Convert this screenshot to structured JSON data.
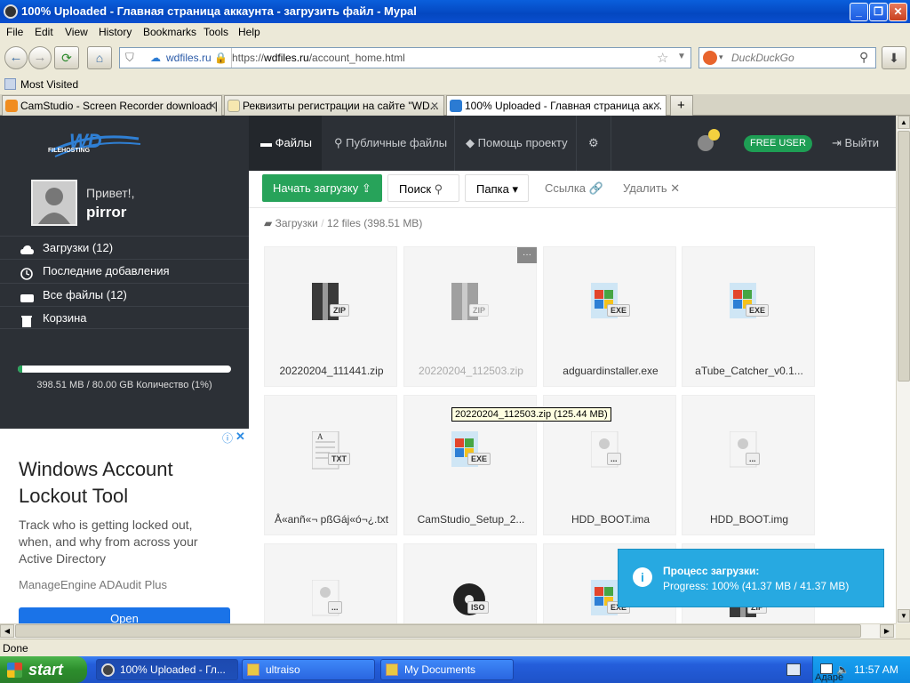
{
  "window": {
    "title": "100% Uploaded - Главная страница аккаунта - загрузить файл - Mypal"
  },
  "menu": [
    "File",
    "Edit",
    "View",
    "History",
    "Bookmarks",
    "Tools",
    "Help"
  ],
  "nav": {
    "site_label": "wdfiles.ru",
    "url_prefix": "https://",
    "url_host": "wdfiles.ru",
    "url_path": "/account_home.html",
    "search_placeholder": "DuckDuckGo"
  },
  "bookmarks": {
    "most_visited": "Most Visited"
  },
  "tabs": [
    {
      "label": "CamStudio - Screen Recorder download | ...",
      "close": "✕"
    },
    {
      "label": "Реквизиты регистрации на сайте \"WD...",
      "close": "✕"
    },
    {
      "label": "100% Uploaded - Главная страница ак...",
      "close": "✕"
    }
  ],
  "new_tab": "+",
  "site": {
    "logo_text": "WD",
    "logo_sub": "FILEHOSTING",
    "greeting": "Привет!,",
    "username": "pirror",
    "sidebar_items": [
      {
        "label": "Загрузки (12)"
      },
      {
        "label": "Последние добавления"
      },
      {
        "label": "Все файлы (12)"
      },
      {
        "label": "Корзина"
      }
    ],
    "storage_text": "398.51 MB / 80.00 GB Количество (1%)",
    "storage_fraction": 0.01,
    "topnav": {
      "files": "Файлы",
      "public_files": "Публичные файлы",
      "help": "Помощь проекту",
      "user_badge": "FREE USER",
      "logout": "Выйти"
    },
    "toolbar": {
      "upload": "Начать загрузку",
      "search": "Поиск",
      "folder": "Папка",
      "link": "Ссылка",
      "delete": "Удалить"
    },
    "breadcrumb": {
      "root": "Загрузки",
      "sep": "/",
      "count": "12 files",
      "size": "(398.51 MB)"
    },
    "files": [
      {
        "name": "20220204_111441.zip",
        "type": "ZIP"
      },
      {
        "name": "20220204_112503.zip",
        "type": "ZIP"
      },
      {
        "name": "adguardinstaller.exe",
        "type": "EXE"
      },
      {
        "name": "aTube_Catcher_v0.1...",
        "type": "EXE"
      },
      {
        "name": "Å«anñ«¬ pßGáj«ó¬¿.txt",
        "type": "TXT"
      },
      {
        "name": "CamStudio_Setup_2...",
        "type": "EXE"
      },
      {
        "name": "HDD_BOOT.ima",
        "type": "..."
      },
      {
        "name": "HDD_BOOT.img",
        "type": "..."
      },
      {
        "name": "",
        "type": "..."
      },
      {
        "name": "",
        "type": "ISO"
      },
      {
        "name": "",
        "type": "EXE"
      },
      {
        "name": "",
        "type": "ZIP"
      }
    ],
    "more_button": "···",
    "tooltip": "20220204_112503.zip (125.44 MB)",
    "notification": {
      "title": "Процесс загрузки:",
      "text": "Progress: 100% (41.37 MB / 41.37 MB)"
    }
  },
  "ad": {
    "title": "Windows Account Lockout Tool",
    "body": "Track who is getting locked out, when, and why from across your Active Directory",
    "brand": "ManageEngine ADAudit Plus",
    "button": "Open"
  },
  "status": "Done",
  "taskbar": {
    "start": "start",
    "tasks": [
      "100% Uploaded - Гл...",
      "ultraiso",
      "My Documents"
    ],
    "clock": "11:57 AM",
    "tray_label": "Aдаре"
  },
  "colors": {
    "site_dark": "#2c3036",
    "upload_green": "#27a35a",
    "free_user_green": "#1e9e54",
    "notify_blue": "#27a9e1"
  }
}
